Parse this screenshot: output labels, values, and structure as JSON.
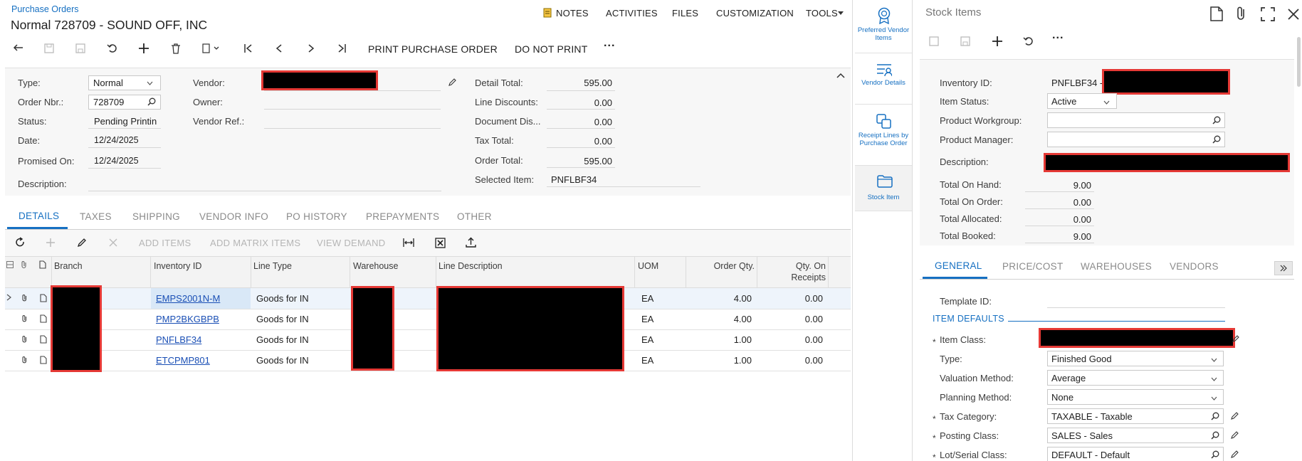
{
  "header": {
    "breadcrumb": "Purchase Orders",
    "title": "Normal 728709 - SOUND OFF, INC",
    "menu": [
      "NOTES",
      "ACTIVITIES",
      "FILES",
      "CUSTOMIZATION",
      "TOOLS"
    ]
  },
  "toolbar": {
    "print_po": "PRINT PURCHASE ORDER",
    "do_not_print": "DO NOT PRINT",
    "more": "···"
  },
  "summary": {
    "type_label": "Type:",
    "type_value": "Normal",
    "order_nbr_label": "Order Nbr.:",
    "order_nbr_value": "728709",
    "status_label": "Status:",
    "status_value": "Pending Printin",
    "date_label": "Date:",
    "date_value": "12/24/2025",
    "promised_label": "Promised On:",
    "promised_value": "12/24/2025",
    "description_label": "Description:",
    "vendor_label": "Vendor:",
    "owner_label": "Owner:",
    "vendor_ref_label": "Vendor Ref.:",
    "detail_total_label": "Detail Total:",
    "detail_total_value": "595.00",
    "line_disc_label": "Line Discounts:",
    "line_disc_value": "0.00",
    "doc_disc_label": "Document Dis...",
    "doc_disc_value": "0.00",
    "tax_total_label": "Tax Total:",
    "tax_total_value": "0.00",
    "order_total_label": "Order Total:",
    "order_total_value": "595.00",
    "selected_item_label": "Selected Item:",
    "selected_item_value": "PNFLBF34"
  },
  "tabs": [
    "DETAILS",
    "TAXES",
    "SHIPPING",
    "VENDOR INFO",
    "PO HISTORY",
    "PREPAYMENTS",
    "OTHER"
  ],
  "grid_toolbar": {
    "add_items": "ADD ITEMS",
    "add_matrix_items": "ADD MATRIX ITEMS",
    "view_demand": "VIEW DEMAND"
  },
  "grid": {
    "columns": [
      "Branch",
      "Inventory ID",
      "Line Type",
      "Warehouse",
      "Line Description",
      "UOM",
      "Order Qty.",
      "Qty. On",
      "Receipts"
    ],
    "rows": [
      {
        "inventory_id": "EMPS2001N-M",
        "line_type": "Goods for IN",
        "uom": "EA",
        "order_qty": "4.00",
        "qty_on_receipts": "0.00"
      },
      {
        "inventory_id": "PMP2BKGBPB",
        "line_type": "Goods for IN",
        "uom": "EA",
        "order_qty": "4.00",
        "qty_on_receipts": "0.00"
      },
      {
        "inventory_id": "PNFLBF34",
        "line_type": "Goods for IN",
        "uom": "EA",
        "order_qty": "1.00",
        "qty_on_receipts": "0.00"
      },
      {
        "inventory_id": "ETCPMP801",
        "line_type": "Goods for IN",
        "uom": "EA",
        "order_qty": "1.00",
        "qty_on_receipts": "0.00"
      }
    ]
  },
  "rail": {
    "preferred_vendor": "Preferred Vendor Items",
    "vendor_details": "Vendor Details",
    "receipt_lines": "Receipt Lines by Purchase Order",
    "stock_item": "Stock Item"
  },
  "side_panel": {
    "title": "Stock Items",
    "inventory_id_label": "Inventory ID:",
    "inventory_id_value": "PNFLBF34 -",
    "item_status_label": "Item Status:",
    "item_status_value": "Active",
    "workgroup_label": "Product Workgroup:",
    "manager_label": "Product Manager:",
    "description_label": "Description:",
    "on_hand_label": "Total On Hand:",
    "on_hand_value": "9.00",
    "on_order_label": "Total On Order:",
    "on_order_value": "0.00",
    "allocated_label": "Total Allocated:",
    "allocated_value": "0.00",
    "booked_label": "Total Booked:",
    "booked_value": "9.00",
    "tabs": [
      "GENERAL",
      "PRICE/COST",
      "WAREHOUSES",
      "VENDORS"
    ],
    "template_id_label": "Template ID:",
    "item_defaults": "ITEM DEFAULTS",
    "item_class_label": "Item Class:",
    "type_label": "Type:",
    "type_value": "Finished Good",
    "valuation_label": "Valuation Method:",
    "valuation_value": "Average",
    "planning_label": "Planning Method:",
    "planning_value": "None",
    "tax_cat_label": "Tax Category:",
    "tax_cat_value": "TAXABLE - Taxable",
    "posting_label": "Posting Class:",
    "posting_value": "SALES - Sales",
    "lot_label": "Lot/Serial Class:",
    "lot_value": "DEFAULT - Default",
    "required_mark": "*"
  },
  "colors": {
    "accent": "#1670c2",
    "link": "#1a4fb5",
    "redact_border": "#e53935"
  }
}
